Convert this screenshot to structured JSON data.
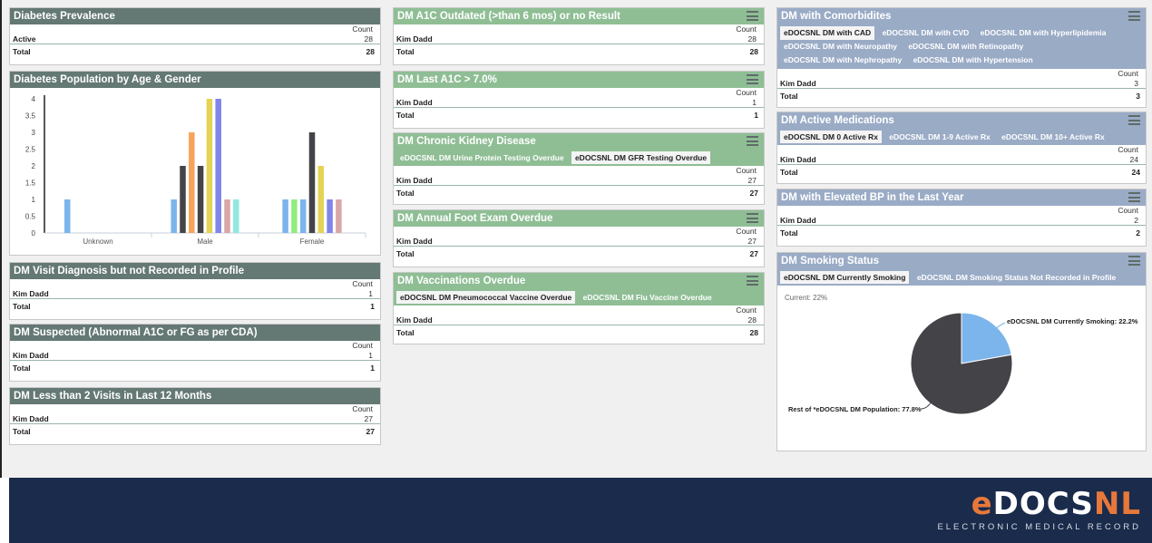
{
  "diabetes_prevalence": {
    "title": "Diabetes Prevalence",
    "count_header": "Count",
    "row_label": "Active",
    "row_value": "28",
    "total_label": "Total",
    "total_value": "28"
  },
  "pop_chart": {
    "title": "Diabetes Population by Age & Gender",
    "chart_data": {
      "type": "bar",
      "categories": [
        "Unknown",
        "Male",
        "Female"
      ],
      "y_ticks": [
        "0",
        "0.5",
        "1",
        "1.5",
        "2",
        "2.5",
        "3",
        "3.5",
        "4"
      ],
      "ylim": [
        0,
        4
      ],
      "bars": [
        {
          "category": "Unknown",
          "value": 1,
          "color": "#7cb5ec"
        },
        {
          "category": "Male",
          "value": 1,
          "color": "#7cb5ec"
        },
        {
          "category": "Male",
          "value": 2,
          "color": "#434348"
        },
        {
          "category": "Male",
          "value": 3,
          "color": "#f7a35c"
        },
        {
          "category": "Male",
          "value": 2,
          "color": "#434348"
        },
        {
          "category": "Male",
          "value": 4,
          "color": "#e4d354"
        },
        {
          "category": "Male",
          "value": 4,
          "color": "#8085e9"
        },
        {
          "category": "Male",
          "value": 1,
          "color": "#d9a7a7"
        },
        {
          "category": "Male",
          "value": 1,
          "color": "#91e8e1"
        },
        {
          "category": "Female",
          "value": 1,
          "color": "#7cb5ec"
        },
        {
          "category": "Female",
          "value": 1,
          "color": "#90ed7d"
        },
        {
          "category": "Female",
          "value": 1,
          "color": "#7cb5ec"
        },
        {
          "category": "Female",
          "value": 3,
          "color": "#434348"
        },
        {
          "category": "Female",
          "value": 2,
          "color": "#e4d354"
        },
        {
          "category": "Female",
          "value": 1,
          "color": "#8085e9"
        },
        {
          "category": "Female",
          "value": 1,
          "color": "#d9a7a7"
        }
      ]
    }
  },
  "visit_dx": {
    "title": "DM Visit Diagnosis but not Recorded in Profile",
    "count_header": "Count",
    "row_label": "Kim Dadd",
    "row_value": "1",
    "total_label": "Total",
    "total_value": "1"
  },
  "suspected": {
    "title": "DM Suspected (Abnormal A1C or FG as per CDA)",
    "count_header": "Count",
    "row_label": "Kim Dadd",
    "row_value": "1",
    "total_label": "Total",
    "total_value": "1"
  },
  "less_visits": {
    "title": "DM Less than 2 Visits in Last 12 Months",
    "count_header": "Count",
    "row_label": "Kim Dadd",
    "row_value": "27",
    "total_label": "Total",
    "total_value": "27"
  },
  "a1c_outdated": {
    "title": "DM A1C Outdated (>than 6 mos) or no Result",
    "count_header": "Count",
    "row_label": "Kim Dadd",
    "row_value": "28",
    "total_label": "Total",
    "total_value": "28"
  },
  "last_a1c": {
    "title": "DM Last A1C > 7.0%",
    "count_header": "Count",
    "row_label": "Kim Dadd",
    "row_value": "1",
    "total_label": "Total",
    "total_value": "1"
  },
  "ckd": {
    "title": "DM Chronic Kidney Disease",
    "tabs": [
      "eDOCSNL DM Urine Protein Testing Overdue",
      "eDOCSNL DM GFR Testing Overdue"
    ],
    "count_header": "Count",
    "row_label": "Kim Dadd",
    "row_value": "27",
    "total_label": "Total",
    "total_value": "27"
  },
  "foot": {
    "title": "DM Annual Foot Exam Overdue",
    "count_header": "Count",
    "row_label": "Kim Dadd",
    "row_value": "27",
    "total_label": "Total",
    "total_value": "27"
  },
  "vacc": {
    "title": "DM Vaccinations Overdue",
    "tabs": [
      "eDOCSNL DM Pneumococcal Vaccine Overdue",
      "eDOCSNL DM Flu Vaccine Overdue"
    ],
    "count_header": "Count",
    "row_label": "Kim Dadd",
    "row_value": "28",
    "total_label": "Total",
    "total_value": "28"
  },
  "comorb": {
    "title": "DM with Comorbidites",
    "tabs": [
      "eDOCSNL DM with CAD",
      "eDOCSNL DM with CVD",
      "eDOCSNL DM with Hyperlipidemia",
      "eDOCSNL DM with Neuropathy",
      "eDOCSNL DM with Retinopathy",
      "eDOCSNL DM with Nephropathy",
      "eDOCSNL DM with Hypertension"
    ],
    "count_header": "Count",
    "row_label": "Kim Dadd",
    "row_value": "3",
    "total_label": "Total",
    "total_value": "3"
  },
  "meds": {
    "title": "DM Active Medications",
    "tabs": [
      "eDOCSNL DM 0 Active Rx",
      "eDOCSNL DM 1-9 Active Rx",
      "eDOCSNL DM 10+ Active Rx"
    ],
    "count_header": "Count",
    "row_label": "Kim Dadd",
    "row_value": "24",
    "total_label": "Total",
    "total_value": "24"
  },
  "bp": {
    "title": "DM with Elevated BP in the Last Year",
    "count_header": "Count",
    "row_label": "Kim Dadd",
    "row_value": "2",
    "total_label": "Total",
    "total_value": "2"
  },
  "smoking": {
    "title": "DM Smoking Status",
    "tabs": [
      "eDOCSNL DM Currently Smoking",
      "eDOCSNL DM Smoking Status Not Recorded in Profile"
    ],
    "current_label": "Current: 22%",
    "chart_data": {
      "type": "pie",
      "slices": [
        {
          "label": "eDOCSNL DM Currently Smoking: 22.2%",
          "value": 22.2,
          "color": "#7cb5ec"
        },
        {
          "label": "Rest of *eDOCSNL DM Population: 77.8%",
          "value": 77.8,
          "color": "#434348"
        }
      ]
    }
  },
  "footer": {
    "logo_e": "e",
    "logo_docs": "DOCS",
    "logo_nl": "NL",
    "tagline": "ELECTRONIC MEDICAL RECORD"
  },
  "icons": {
    "menu": "hamburger-menu-icon"
  }
}
